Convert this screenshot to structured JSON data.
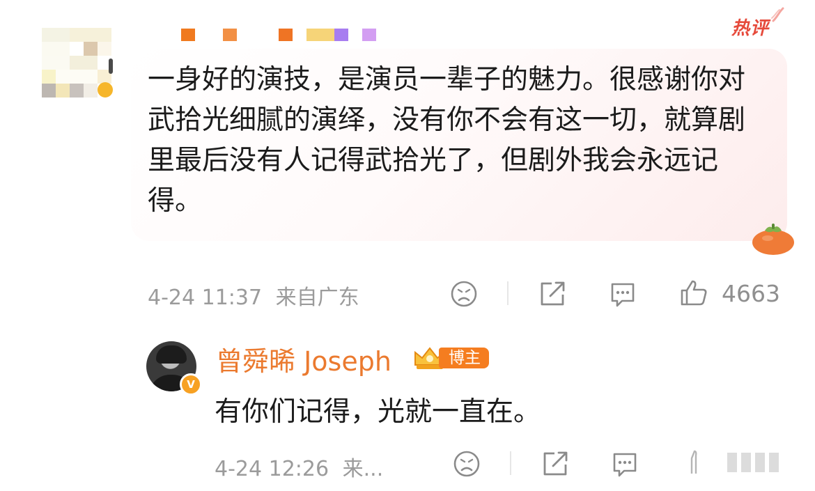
{
  "colors": {
    "accent": "#eb7a2f",
    "hot": "#e64a3b",
    "meta_gray": "#9b9b9b",
    "text": "#1b1b1b"
  },
  "comment": {
    "hot_badge": "热评",
    "text": "一身好的演技，是演员一辈子的魅力。很感谢你对武拾光细腻的演绎，没有你不会有这一切，就算剧里最后没有人记得武拾光了，但剧外我会永远记得。",
    "date_time": "4-24 11:37",
    "location": "来自广东",
    "like_count": "4663",
    "icons": [
      "dislike-face-icon",
      "share-icon",
      "comment-icon",
      "thumbs-up-icon"
    ]
  },
  "reply": {
    "author": "曾舜晞 Joseph",
    "badge": "博主",
    "verified_mark": "V",
    "text": "有你们记得，光就一直在。",
    "date_time": "4-24 12:26",
    "location_truncated": "来...",
    "icons": [
      "dislike-face-icon",
      "share-icon",
      "comment-icon"
    ]
  }
}
